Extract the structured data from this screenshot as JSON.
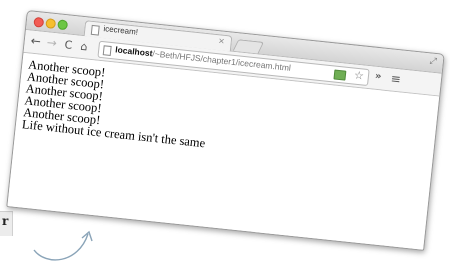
{
  "browser": {
    "tab_title": "icecream!",
    "tab_close": "×",
    "url_host": "localhost",
    "url_path": "/~Beth/HFJS/chapter1/icecream.html",
    "toolbar": {
      "back": "←",
      "forward": "→",
      "reload": "C",
      "home": "⌂",
      "overflow": "»",
      "menu": "≡"
    },
    "resize": "⤢"
  },
  "page": {
    "lines": [
      "Another scoop!",
      "Another scoop!",
      "Another scoop!",
      "Another scoop!",
      "Another scoop!"
    ],
    "closing": "Life without ice cream isn't the same"
  },
  "decor": {
    "corner_glyph": "r"
  }
}
